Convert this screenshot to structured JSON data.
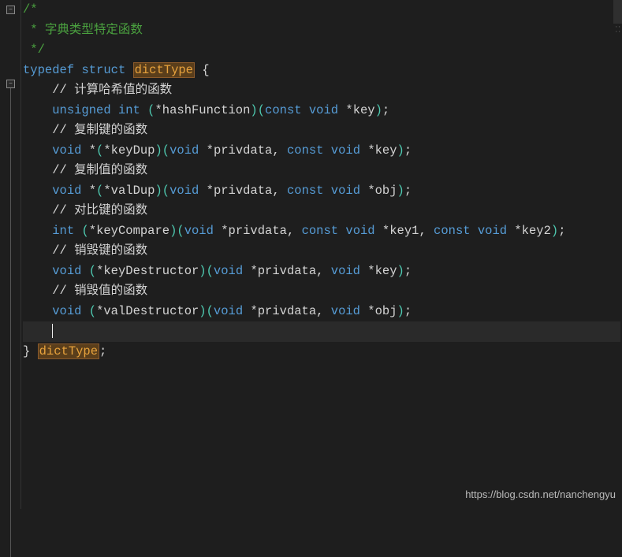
{
  "fold": {
    "glyph1": "−",
    "glyph2": "−"
  },
  "lines": {
    "c1a": "/*",
    "c1b": " * 字典类型特定函数",
    "c1c": " */",
    "typedef": "typedef",
    "struct": "struct",
    "typename": "dictType",
    "obrace": " {",
    "blank": "",
    "indent": "    ",
    "c_hash": "// 计算哈希值的函数",
    "kw_unsigned": "unsigned",
    "kw_int": "int",
    "star": "*",
    "fn_hash": "hashFunction",
    "kw_const": "const",
    "kw_void": "void",
    "id_key": "key",
    "semi": ";",
    "c_keydup": "// 复制键的函数",
    "fn_keydup": "keyDup",
    "id_priv": "privdata",
    "c_valdup": "// 复制值的函数",
    "fn_valdup": "valDup",
    "id_obj": "obj",
    "c_cmp": "// 对比键的函数",
    "fn_cmp": "keyCompare",
    "id_key1": "key1",
    "id_key2": "key2",
    "c_kdes": "// 销毁键的函数",
    "fn_kdes": "keyDestructor",
    "c_vdes": "// 销毁值的函数",
    "fn_vdes": "valDestructor",
    "cbrace": "}",
    "space": " "
  },
  "watermark": "https://blog.csdn.net/nanchengyu"
}
